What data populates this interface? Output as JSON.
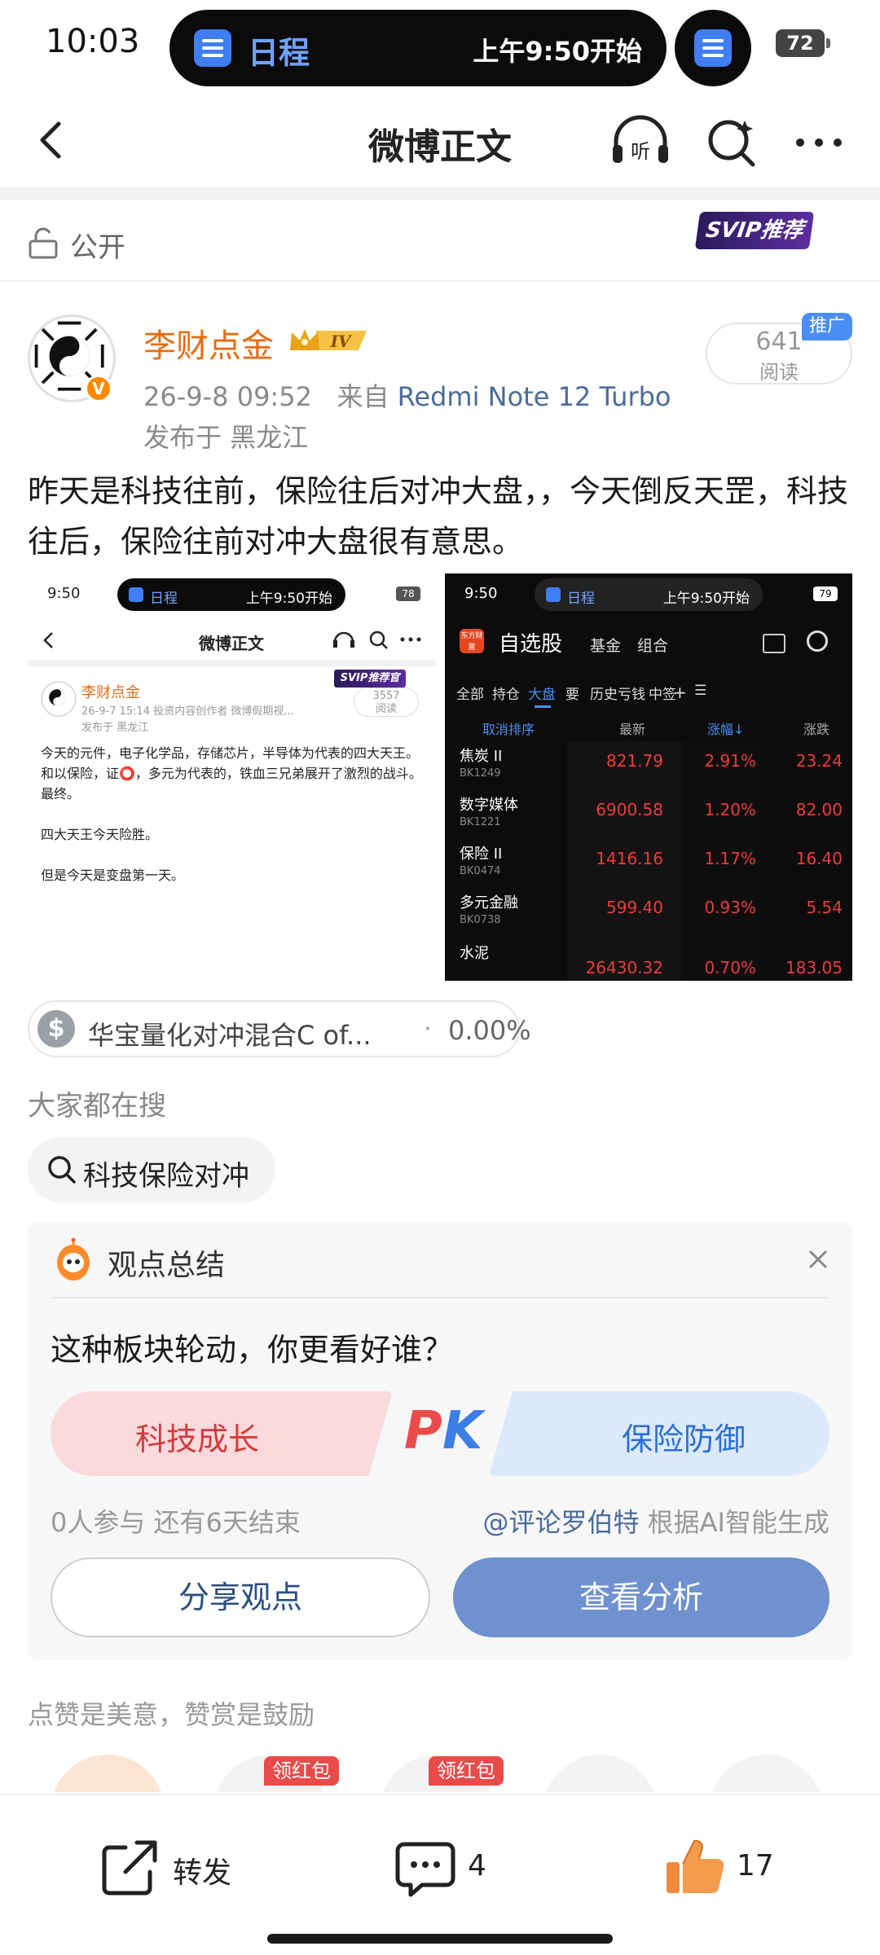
{
  "status_bar": {
    "time": "10:03",
    "island_app": "日程",
    "island_event": "上午9:50开始",
    "battery": "72"
  },
  "nav": {
    "title": "微博正文",
    "icons": [
      "back-icon",
      "listen-icon",
      "search-icon",
      "more-icon"
    ]
  },
  "visibility": {
    "label": "公开",
    "svip_badge": "SVIP推荐官"
  },
  "post": {
    "author": "李财点金",
    "level": "IV",
    "date": "26-9-8 09:52",
    "source_prefix": "来自",
    "device": "Redmi Note 12 Turbo",
    "location": "发布于 黑龙江",
    "read_count": "641",
    "read_label": "阅读",
    "promo_tag": "推广",
    "body": "昨天是科技往前，保险往后对冲大盘，，今天倒反天罡，科技往后，保险往前对冲大盘很有意思。"
  },
  "image_left": {
    "time": "9:50",
    "island_app": "日程",
    "island_event": "上午9:50开始",
    "battery": "78",
    "nav_title": "微博正文",
    "svip": "SVIP推荐官",
    "author": "李财点金",
    "meta": "26-9-7 15:14  投资内容创作者 微博假期视...",
    "meta2": "发布于 黑龙江",
    "read_count": "3557",
    "read_label": "阅读",
    "lines": [
      "今天的元件，电子化学品，存储芯片，半导体为代表的四大天王。",
      "和以保险，证⭕，多元为代表的，铁血三兄弟展开了激烈的战斗。",
      "最终。",
      "",
      "四大天王今天险胜。",
      "",
      "但是今天是变盘第一天。"
    ]
  },
  "image_right": {
    "time": "9:50",
    "island_app": "日程",
    "island_event": "上午9:50开始",
    "battery": "79",
    "logo": "东方财富",
    "title": "自选股",
    "tab2": "基金",
    "tab3": "组合",
    "tabs": [
      "全部",
      "持仓",
      "大盘",
      "要",
      "历史亏钱",
      "中签",
      "+",
      "☰"
    ],
    "col_cancel": "取消排序",
    "col_latest": "最新",
    "col_rise": "涨幅↓",
    "col_change": "涨跌",
    "rows": [
      {
        "name": "焦炭 II",
        "code": "BK1249",
        "price": "821.79",
        "pct": "2.91%",
        "chg": "23.24"
      },
      {
        "name": "数字媒体",
        "code": "BK1221",
        "price": "6900.58",
        "pct": "1.20%",
        "chg": "82.00"
      },
      {
        "name": "保险 II",
        "code": "BK0474",
        "price": "1416.16",
        "pct": "1.17%",
        "chg": "16.40"
      },
      {
        "name": "多元金融",
        "code": "BK0738",
        "price": "599.40",
        "pct": "0.93%",
        "chg": "5.54"
      },
      {
        "name": "水泥",
        "code": "",
        "price": "26430.32",
        "pct": "0.70%",
        "chg": "183.05"
      }
    ]
  },
  "fund": {
    "icon": "$",
    "name": "华宝量化对冲混合C of...",
    "dot": "·",
    "rate": "0.00%"
  },
  "search": {
    "title": "大家都在搜",
    "chip": "科技保险对冲"
  },
  "opinion": {
    "title": "观点总结",
    "question": "这种板块轮动，你更看好谁？",
    "left": "科技成长",
    "right": "保险防御",
    "pk_p": "P",
    "pk_k": "K",
    "stats": "0人参与  还有6天结束",
    "credit_at": "@评论罗伯特",
    "credit_rest": " 根据AI智能生成",
    "share": "分享观点",
    "analysis": "查看分析"
  },
  "tip": {
    "title": "点赞是美意，赞赏是鼓励",
    "redpack": "领红包"
  },
  "bottom": {
    "repost": "转发",
    "comment": "4",
    "like": "17"
  },
  "colors": {
    "accent_orange": "#e86b10",
    "link_blue": "#4a6b9a",
    "pk_red": "#d43a3a",
    "pk_blue": "#2b6fd6",
    "button_blue": "#6f91cf"
  }
}
